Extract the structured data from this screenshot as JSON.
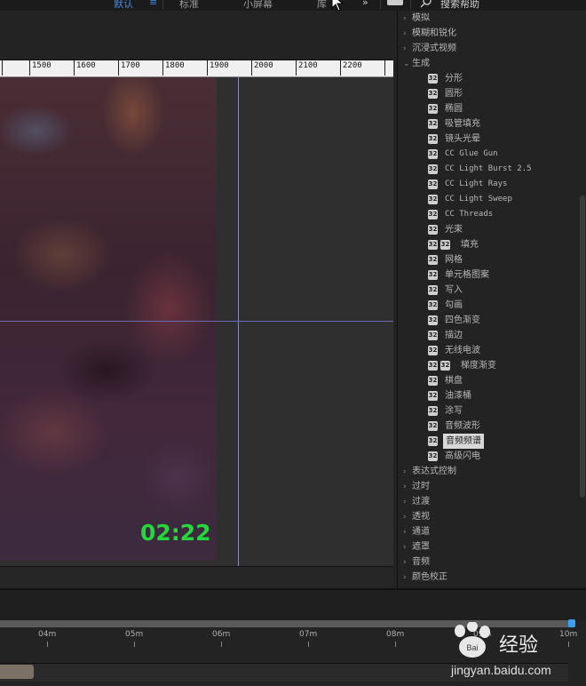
{
  "workspace": {
    "tabs": [
      "默认",
      "标准",
      "小屏幕",
      "库"
    ],
    "active": "默认",
    "overflow": "»",
    "search_placeholder": "搜索帮助"
  },
  "ruler": {
    "labels": [
      "1500",
      "1600",
      "1700",
      "1800",
      "1900",
      "2000",
      "2100",
      "2200"
    ]
  },
  "viewer": {
    "timecode": "02:22"
  },
  "effects": {
    "categories_top": [
      "模拟",
      "模糊和锐化",
      "沉浸式视频"
    ],
    "expanded_category": "生成",
    "items": [
      {
        "label": "分形",
        "badges": 1,
        "mono": false
      },
      {
        "label": "圆形",
        "badges": 1,
        "mono": false
      },
      {
        "label": "椭圆",
        "badges": 1,
        "mono": false
      },
      {
        "label": "吸管填充",
        "badges": 1,
        "mono": false
      },
      {
        "label": "镜头光晕",
        "badges": 1,
        "mono": false
      },
      {
        "label": "CC Glue Gun",
        "badges": 1,
        "mono": true
      },
      {
        "label": "CC Light Burst 2.5",
        "badges": 1,
        "mono": true
      },
      {
        "label": "CC Light Rays",
        "badges": 1,
        "mono": true
      },
      {
        "label": "CC Light Sweep",
        "badges": 1,
        "mono": true
      },
      {
        "label": "CC Threads",
        "badges": 1,
        "mono": true
      },
      {
        "label": "光束",
        "badges": 1,
        "mono": false
      },
      {
        "label": "填充",
        "badges": 2,
        "mono": false
      },
      {
        "label": "网格",
        "badges": 1,
        "mono": false
      },
      {
        "label": "单元格图案",
        "badges": 1,
        "mono": false
      },
      {
        "label": "写入",
        "badges": 1,
        "mono": false
      },
      {
        "label": "勾画",
        "badges": 1,
        "mono": false
      },
      {
        "label": "四色渐变",
        "badges": 1,
        "mono": false
      },
      {
        "label": "描边",
        "badges": 1,
        "mono": false
      },
      {
        "label": "无线电波",
        "badges": 1,
        "mono": false
      },
      {
        "label": "梯度渐变",
        "badges": 2,
        "mono": false
      },
      {
        "label": "棋盘",
        "badges": 1,
        "mono": false
      },
      {
        "label": "油漆桶",
        "badges": 1,
        "mono": false
      },
      {
        "label": "涂写",
        "badges": 1,
        "mono": false
      },
      {
        "label": "音频波形",
        "badges": 1,
        "mono": false
      },
      {
        "label": "音频频谱",
        "badges": 1,
        "mono": false,
        "selected": true
      },
      {
        "label": "高级闪电",
        "badges": 1,
        "mono": false
      }
    ],
    "categories_bottom": [
      "表达式控制",
      "过时",
      "过渡",
      "透视",
      "通道",
      "遮罩",
      "音频",
      "颜色校正"
    ],
    "badge_text": "32"
  },
  "timeline": {
    "labels": [
      "04m",
      "05m",
      "06m",
      "07m",
      "08m",
      "09m",
      "10m"
    ]
  },
  "watermark": {
    "brand": "经验",
    "url": "jingyan.baidu.com",
    "logo_text": "Bai"
  }
}
